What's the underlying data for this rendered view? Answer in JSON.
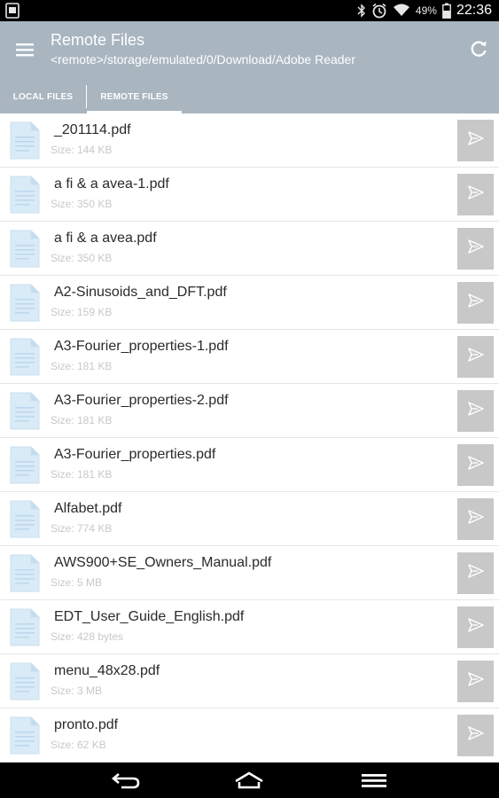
{
  "status_bar": {
    "battery_percent": "49%",
    "time": "22:36",
    "icons": [
      "screenshot-icon",
      "bluetooth-icon",
      "alarm-icon",
      "wifi-icon",
      "battery-icon"
    ]
  },
  "app_bar": {
    "title": "Remote Files",
    "subtitle": "<remote>/storage/emulated/0/Download/Adobe Reader",
    "tabs": [
      {
        "label": "LOCAL FILES",
        "active": false
      },
      {
        "label": "REMOTE FILES",
        "active": true
      }
    ]
  },
  "files": [
    {
      "name": "_201114.pdf",
      "size": "Size: 144 KB"
    },
    {
      "name": "a fi & a avea-1.pdf",
      "size": "Size: 350 KB"
    },
    {
      "name": "a fi & a avea.pdf",
      "size": "Size: 350 KB"
    },
    {
      "name": "A2-Sinusoids_and_DFT.pdf",
      "size": "Size: 159 KB"
    },
    {
      "name": "A3-Fourier_properties-1.pdf",
      "size": "Size: 181 KB"
    },
    {
      "name": "A3-Fourier_properties-2.pdf",
      "size": "Size: 181 KB"
    },
    {
      "name": "A3-Fourier_properties.pdf",
      "size": "Size: 181 KB"
    },
    {
      "name": "Alfabet.pdf",
      "size": "Size: 774 KB"
    },
    {
      "name": "AWS900+SE_Owners_Manual.pdf",
      "size": "Size: 5 MB"
    },
    {
      "name": "EDT_User_Guide_English.pdf",
      "size": "Size: 428 bytes"
    },
    {
      "name": "menu_48x28.pdf",
      "size": "Size: 3 MB"
    },
    {
      "name": "pronto.pdf",
      "size": "Size: 62 KB"
    }
  ],
  "colors": {
    "app_bar": "#a9b6c0",
    "file_icon": "#d9ebf7",
    "send_button": "#c8c8c8",
    "divider": "#e6e6e6"
  }
}
